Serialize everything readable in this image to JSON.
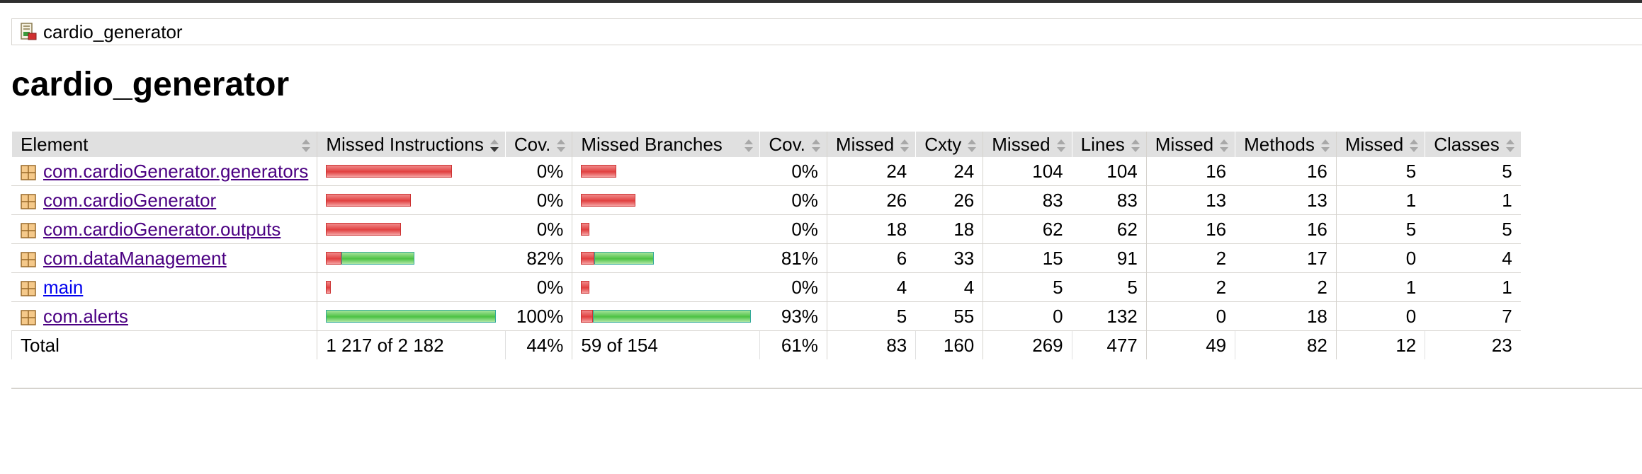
{
  "breadcrumb": {
    "icon": "report-icon",
    "label": "cardio_generator"
  },
  "page_title": "cardio_generator",
  "columns": {
    "element": "Element",
    "missed_instructions": "Missed Instructions",
    "cov1": "Cov.",
    "missed_branches": "Missed Branches",
    "cov2": "Cov.",
    "missed_cxty": "Missed",
    "cxty": "Cxty",
    "missed_lines": "Missed",
    "lines": "Lines",
    "missed_methods": "Missed",
    "methods": "Methods",
    "missed_classes": "Missed",
    "classes": "Classes"
  },
  "colors": {
    "missed_bar": "#e14040",
    "covered_bar": "#4cc244"
  },
  "rows": [
    {
      "name": "com.cardioGenerator.generators",
      "visited": true,
      "instr_cov": "0%",
      "branch_cov": "0%",
      "missed_cxty": "24",
      "cxty": "24",
      "missed_lines": "104",
      "lines": "104",
      "missed_methods": "16",
      "methods": "16",
      "missed_classes": "5",
      "classes": "5",
      "instr_missed_frac": 0.74,
      "instr_covered_frac": 0.0,
      "branch_missed_frac": 0.21,
      "branch_covered_frac": 0.0
    },
    {
      "name": "com.cardioGenerator",
      "visited": true,
      "instr_cov": "0%",
      "branch_cov": "0%",
      "missed_cxty": "26",
      "cxty": "26",
      "missed_lines": "83",
      "lines": "83",
      "missed_methods": "13",
      "methods": "13",
      "missed_classes": "1",
      "classes": "1",
      "instr_missed_frac": 0.5,
      "instr_covered_frac": 0.0,
      "branch_missed_frac": 0.32,
      "branch_covered_frac": 0.0
    },
    {
      "name": "com.cardioGenerator.outputs",
      "visited": true,
      "instr_cov": "0%",
      "branch_cov": "0%",
      "missed_cxty": "18",
      "cxty": "18",
      "missed_lines": "62",
      "lines": "62",
      "missed_methods": "16",
      "methods": "16",
      "missed_classes": "5",
      "classes": "5",
      "instr_missed_frac": 0.44,
      "instr_covered_frac": 0.0,
      "branch_missed_frac": 0.05,
      "branch_covered_frac": 0.0
    },
    {
      "name": "com.dataManagement",
      "visited": true,
      "instr_cov": "82%",
      "branch_cov": "81%",
      "missed_cxty": "6",
      "cxty": "33",
      "missed_lines": "15",
      "lines": "91",
      "missed_methods": "2",
      "methods": "17",
      "missed_classes": "0",
      "classes": "4",
      "instr_missed_frac": 0.09,
      "instr_covered_frac": 0.43,
      "branch_missed_frac": 0.08,
      "branch_covered_frac": 0.35
    },
    {
      "name": "main",
      "visited": false,
      "instr_cov": "0%",
      "branch_cov": "0%",
      "missed_cxty": "4",
      "cxty": "4",
      "missed_lines": "5",
      "lines": "5",
      "missed_methods": "2",
      "methods": "2",
      "missed_classes": "1",
      "classes": "1",
      "instr_missed_frac": 0.03,
      "instr_covered_frac": 0.0,
      "branch_missed_frac": 0.05,
      "branch_covered_frac": 0.0
    },
    {
      "name": "com.alerts",
      "visited": true,
      "instr_cov": "100%",
      "branch_cov": "93%",
      "missed_cxty": "5",
      "cxty": "55",
      "missed_lines": "0",
      "lines": "132",
      "missed_methods": "0",
      "methods": "18",
      "missed_classes": "0",
      "classes": "7",
      "instr_missed_frac": 0.0,
      "instr_covered_frac": 1.0,
      "branch_missed_frac": 0.07,
      "branch_covered_frac": 0.93
    }
  ],
  "total": {
    "label": "Total",
    "instructions": "1 217 of 2 182",
    "instr_cov": "44%",
    "branches": "59 of 154",
    "branch_cov": "61%",
    "missed_cxty": "83",
    "cxty": "160",
    "missed_lines": "269",
    "lines": "477",
    "missed_methods": "49",
    "methods": "82",
    "missed_classes": "12",
    "classes": "23"
  }
}
